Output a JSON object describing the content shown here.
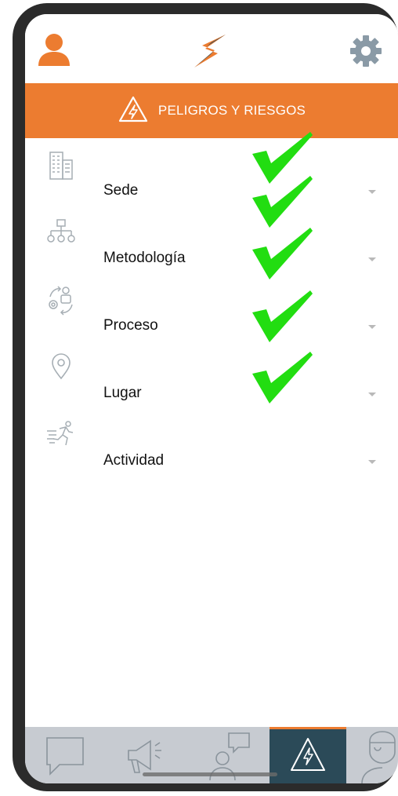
{
  "header": {
    "banner_title": "PELIGROS Y RIESGOS"
  },
  "colors": {
    "brand_orange": "#ec7c30",
    "tab_active_bg": "#2b4a58",
    "tabbar_bg": "#c7cbd1",
    "checkmark": "#22dd11"
  },
  "fields": [
    {
      "label": "Sede",
      "icon": "building-icon",
      "checked": true
    },
    {
      "label": "Metodología",
      "icon": "org-chart-icon",
      "checked": true
    },
    {
      "label": "Proceso",
      "icon": "process-cycle-icon",
      "checked": true
    },
    {
      "label": "Lugar",
      "icon": "location-pin-icon",
      "checked": true
    },
    {
      "label": "Actividad",
      "icon": "running-person-icon",
      "checked": false
    }
  ],
  "tabbar": {
    "items": [
      {
        "icon": "chat-bubble-icon",
        "active": false
      },
      {
        "icon": "megaphone-icon",
        "active": false
      },
      {
        "icon": "person-chat-icon",
        "active": false
      },
      {
        "icon": "hazard-warning-icon",
        "active": true
      },
      {
        "icon": "doctor-icon",
        "active": false
      }
    ]
  }
}
